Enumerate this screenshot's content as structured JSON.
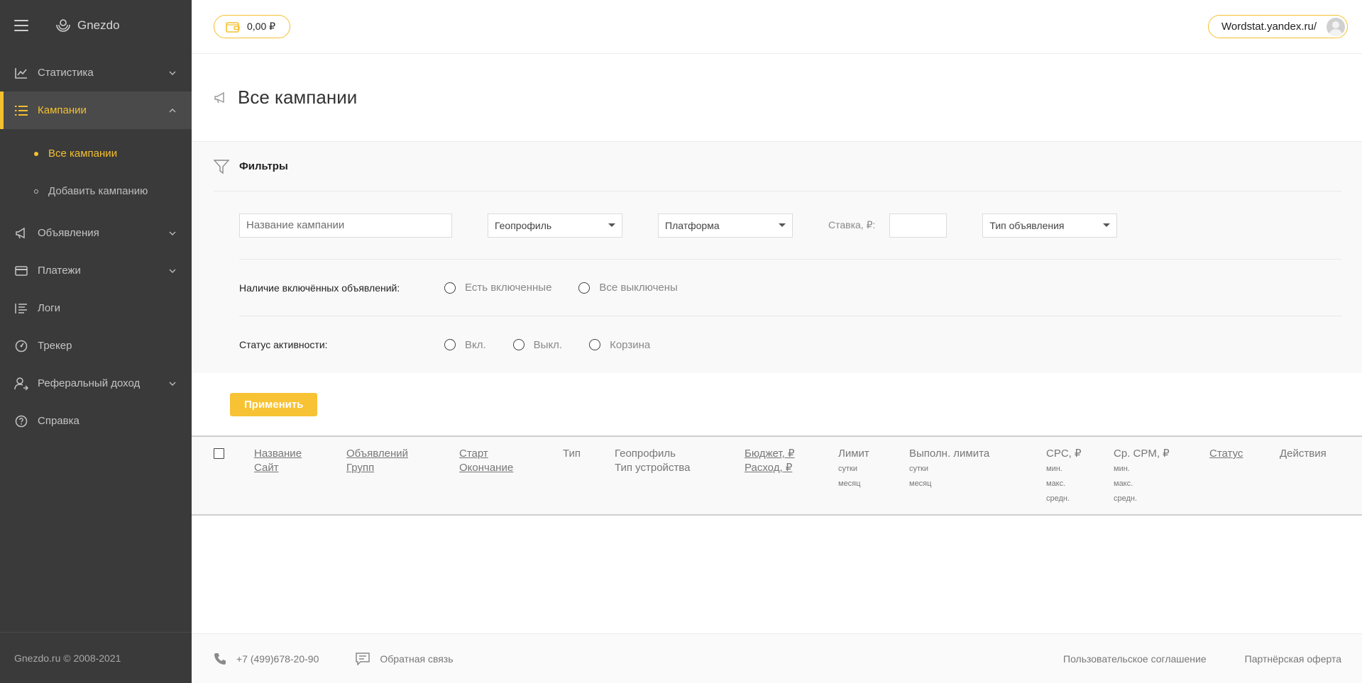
{
  "brand": {
    "name": "Gnezdo"
  },
  "sidebar": {
    "items": [
      {
        "label": "Статистика",
        "icon": "chart-line-icon",
        "expandable": true
      },
      {
        "label": "Кампании",
        "icon": "list-icon",
        "expandable": true,
        "active": true
      },
      {
        "label": "Объявления",
        "icon": "megaphone-icon",
        "expandable": true
      },
      {
        "label": "Платежи",
        "icon": "credit-card-icon",
        "expandable": true
      },
      {
        "label": "Логи",
        "icon": "log-list-icon",
        "expandable": false
      },
      {
        "label": "Трекер",
        "icon": "gauge-icon",
        "expandable": false
      },
      {
        "label": "Реферальный доход",
        "icon": "user-arrow-icon",
        "expandable": true
      },
      {
        "label": "Справка",
        "icon": "help-icon",
        "expandable": false
      }
    ],
    "sub_items": [
      {
        "label": "Все кампании",
        "active": true
      },
      {
        "label": "Добавить кампанию",
        "active": false
      }
    ],
    "copyright": "Gnezdo.ru © 2008-2021"
  },
  "header": {
    "balance": "0,00 ₽",
    "account": "Wordstat.yandex.ru/"
  },
  "page": {
    "title": "Все кампании"
  },
  "filters": {
    "title": "Фильтры",
    "campaign_name_placeholder": "Название кампании",
    "geoprofile": "Геопрофиль",
    "platform": "Платформа",
    "rate_label": "Ставка, ₽:",
    "ad_type": "Тип объявления",
    "enabled_ads_label": "Наличие включённых объявлений:",
    "enabled_ads_options": [
      "Есть включенные",
      "Все выключены"
    ],
    "activity_label": "Статус активности:",
    "activity_options": [
      "Вкл.",
      "Выкл.",
      "Корзина"
    ],
    "apply": "Применить"
  },
  "table": {
    "columns": {
      "name": "Название",
      "site": "Сайт",
      "ads": "Объявлений",
      "groups": "Групп",
      "start": "Старт",
      "end": "Окончание",
      "type": "Тип",
      "geo": "Геопрофиль",
      "device": "Тип устройства",
      "budget": "Бюджет, ₽",
      "spend": "Расход, ₽",
      "limit": "Лимит",
      "limit_day": "сутки",
      "limit_month": "месяц",
      "limit_done": "Выполн. лимита",
      "done_day": "сутки",
      "done_month": "месяц",
      "cpc": "CPC, ₽",
      "cpc_min": "мин.",
      "cpc_max": "макс.",
      "cpc_avg": "средн.",
      "cpm": "Ср. CPM, ₽",
      "cpm_min": "мин.",
      "cpm_max": "макс.",
      "cpm_avg": "средн.",
      "status": "Статус",
      "actions": "Действия"
    },
    "rows": []
  },
  "footer": {
    "phone": "+7 (499)678-20-90",
    "feedback": "Обратная связь",
    "terms": "Пользовательское соглашение",
    "offer": "Партнёрская оферта"
  },
  "colors": {
    "accent": "#f4c030",
    "sidebar_bg": "#3a3a3a",
    "apply_bg": "#f7c233"
  }
}
